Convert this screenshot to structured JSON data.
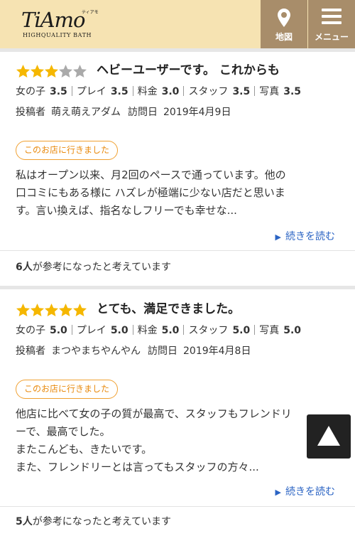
{
  "header": {
    "logo_main": "TiAmo",
    "logo_kana": "ティアモ",
    "logo_sub": "HIGHQUALITY BATH",
    "map_label": "地図",
    "menu_label": "メニュー"
  },
  "colors": {
    "header_bg": "#f6e3b2",
    "header_button_bg": "#a88d6a",
    "star_filled": "#f5b700",
    "star_empty": "#aaaaaa",
    "badge_orange": "#e8890c",
    "link_blue": "#2b64c4"
  },
  "icons": {
    "map": "map-pin-icon",
    "menu": "hamburger-icon",
    "star": "star-icon",
    "read_more": "triangle-right-icon",
    "scroll_top": "triangle-up-icon"
  },
  "reviews": [
    {
      "rating": 3,
      "max_rating": 5,
      "title": "ヘビーユーザーです。 これからも",
      "scores": [
        {
          "label": "女の子",
          "value": "3.5"
        },
        {
          "label": "プレイ",
          "value": "3.5"
        },
        {
          "label": "料金",
          "value": "3.0"
        },
        {
          "label": "スタッフ",
          "value": "3.5"
        },
        {
          "label": "写真",
          "value": "3.5"
        }
      ],
      "poster_label": "投稿者",
      "poster": "萌え萌えアダム",
      "visit_label": "訪問日",
      "visit_date": "2019年4月9日",
      "badge": "このお店に行きました",
      "body": [
        "私はオープン以来、月2回のペースで通っています。他の",
        "口コミにもある様に ハズレが極端に少ない店だと思いま",
        "す。言い換えば、指名なしフリーでも幸せな..."
      ],
      "read_more": "続きを読む",
      "helpful_count": "6人",
      "helpful_text": "が参考になったと考えています"
    },
    {
      "rating": 5,
      "max_rating": 5,
      "title": "とても、満足できました。",
      "scores": [
        {
          "label": "女の子",
          "value": "5.0"
        },
        {
          "label": "プレイ",
          "value": "5.0"
        },
        {
          "label": "料金",
          "value": "5.0"
        },
        {
          "label": "スタッフ",
          "value": "5.0"
        },
        {
          "label": "写真",
          "value": "5.0"
        }
      ],
      "poster_label": "投稿者",
      "poster": "まつやまちやんやん",
      "visit_label": "訪問日",
      "visit_date": "2019年4月8日",
      "badge": "このお店に行きました",
      "body": [
        "他店に比べて女の子の質が最高で、スタッフもフレンドリ",
        "ーで、最高でした。",
        "またこんども、きたいです。",
        "また、フレンドリーとは言ってもスタッフの方々..."
      ],
      "read_more": "続きを読む",
      "helpful_count": "5人",
      "helpful_text": "が参考になったと考えています"
    }
  ]
}
